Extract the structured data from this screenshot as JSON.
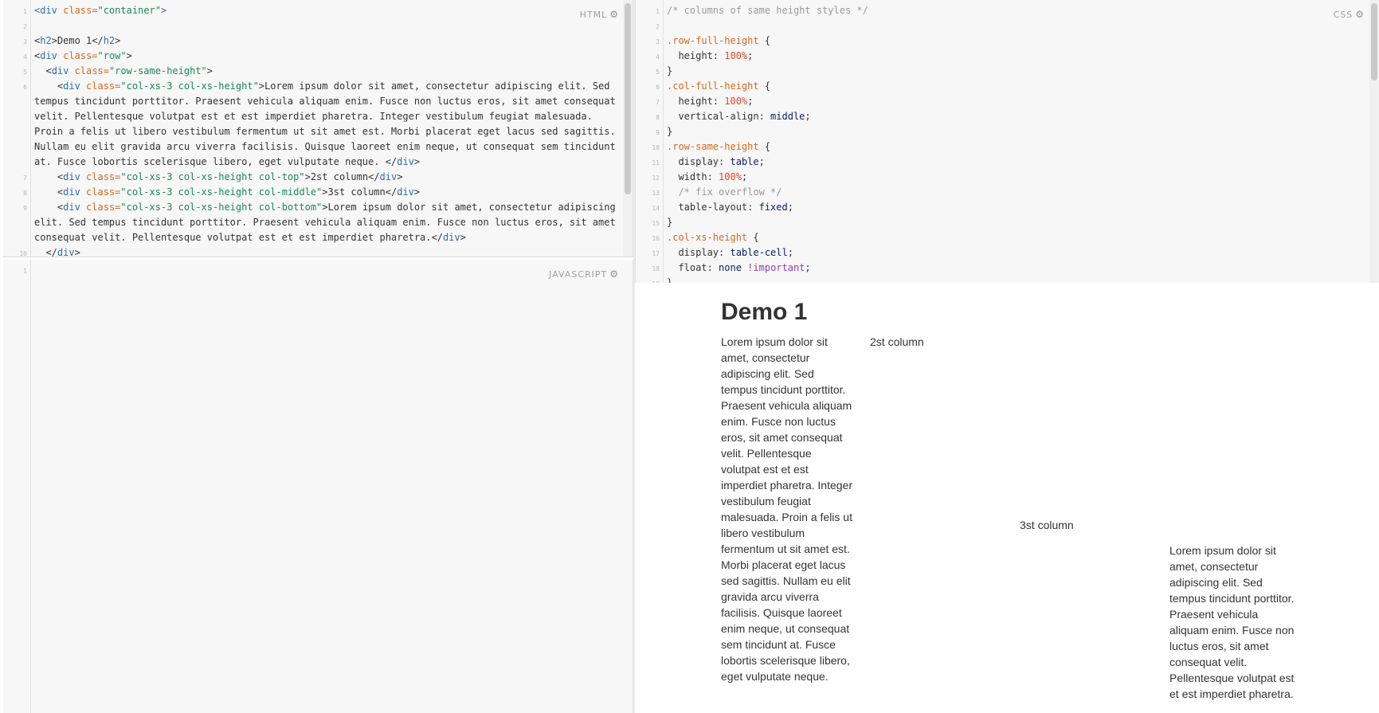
{
  "panes": {
    "html_label": "HTML",
    "js_label": "JAVASCRIPT",
    "css_label": "CSS",
    "gear_icon": "gear-icon"
  },
  "html_code": [
    {
      "n": "1",
      "segs": [
        [
          "t",
          "<div "
        ],
        [
          "a",
          "class="
        ],
        [
          "s",
          "\"container\""
        ],
        [
          "t",
          ">"
        ]
      ]
    },
    {
      "n": "2",
      "segs": []
    },
    {
      "n": "3",
      "segs": [
        [
          "p",
          "<"
        ],
        [
          "t",
          "h2"
        ],
        [
          "p",
          ">Demo 1</"
        ],
        [
          "t",
          "h2"
        ],
        [
          "p",
          ">"
        ]
      ]
    },
    {
      "n": "4",
      "segs": [
        [
          "p",
          "<"
        ],
        [
          "t",
          "div "
        ],
        [
          "a",
          "class="
        ],
        [
          "s",
          "\"row\""
        ],
        [
          "p",
          ">"
        ]
      ]
    },
    {
      "n": "5",
      "segs": [
        [
          "p",
          "  <"
        ],
        [
          "t",
          "div "
        ],
        [
          "a",
          "class="
        ],
        [
          "s",
          "\"row-same-height\""
        ],
        [
          "p",
          ">"
        ]
      ]
    },
    {
      "n": "6",
      "segs": [
        [
          "p",
          "    <"
        ],
        [
          "t",
          "div "
        ],
        [
          "a",
          "class="
        ],
        [
          "s",
          "\"col-xs-3 col-xs-height\""
        ],
        [
          "p",
          ">Lorem ipsum dolor sit amet, consectetur adipiscing elit. Sed tempus tincidunt porttitor. Praesent vehicula aliquam enim. Fusce non luctus eros, sit amet consequat velit. Pellentesque volutpat est et est imperdiet pharetra. Integer vestibulum feugiat malesuada. Proin a felis ut libero vestibulum fermentum ut sit amet est. Morbi placerat eget lacus sed sagittis. Nullam eu elit gravida arcu viverra facilisis. Quisque laoreet enim neque, ut consequat sem tincidunt at. Fusce lobortis scelerisque libero, eget vulputate neque. </"
        ],
        [
          "t",
          "div"
        ],
        [
          "p",
          ">"
        ]
      ]
    },
    {
      "n": "7",
      "segs": [
        [
          "p",
          "    <"
        ],
        [
          "t",
          "div "
        ],
        [
          "a",
          "class="
        ],
        [
          "s",
          "\"col-xs-3 col-xs-height col-top\""
        ],
        [
          "p",
          ">2st column</"
        ],
        [
          "t",
          "div"
        ],
        [
          "p",
          ">"
        ]
      ]
    },
    {
      "n": "8",
      "segs": [
        [
          "p",
          "    <"
        ],
        [
          "t",
          "div "
        ],
        [
          "a",
          "class="
        ],
        [
          "s",
          "\"col-xs-3 col-xs-height col-middle\""
        ],
        [
          "p",
          ">3st column</"
        ],
        [
          "t",
          "div"
        ],
        [
          "p",
          ">"
        ]
      ]
    },
    {
      "n": "9",
      "segs": [
        [
          "p",
          "    <"
        ],
        [
          "t",
          "div "
        ],
        [
          "a",
          "class="
        ],
        [
          "s",
          "\"col-xs-3 col-xs-height col-bottom\""
        ],
        [
          "p",
          ">Lorem ipsum dolor sit amet, consectetur adipiscing elit. Sed tempus tincidunt porttitor. Praesent vehicula aliquam enim. Fusce non luctus eros, sit amet consequat velit. Pellentesque volutpat est et est imperdiet pharetra.</"
        ],
        [
          "t",
          "div"
        ],
        [
          "p",
          ">"
        ]
      ]
    },
    {
      "n": "10",
      "segs": [
        [
          "p",
          "  </"
        ],
        [
          "t",
          "div"
        ],
        [
          "p",
          ">"
        ]
      ]
    }
  ],
  "js_code": [
    {
      "n": "1",
      "segs": []
    }
  ],
  "css_code": [
    {
      "n": "1",
      "segs": [
        [
          "cm",
          "/* columns of same height styles */"
        ]
      ]
    },
    {
      "n": "2",
      "segs": []
    },
    {
      "n": "3",
      "segs": [
        [
          "sel",
          ".row-full-height"
        ],
        [
          "p",
          " {"
        ]
      ]
    },
    {
      "n": "4",
      "segs": [
        [
          "p",
          "  height: "
        ],
        [
          "num",
          "100%"
        ],
        [
          "p",
          ";"
        ]
      ]
    },
    {
      "n": "5",
      "segs": [
        [
          "p",
          "}"
        ]
      ]
    },
    {
      "n": "6",
      "segs": [
        [
          "sel",
          ".col-full-height"
        ],
        [
          "p",
          " {"
        ]
      ]
    },
    {
      "n": "7",
      "segs": [
        [
          "p",
          "  height: "
        ],
        [
          "num",
          "100%"
        ],
        [
          "p",
          ";"
        ]
      ]
    },
    {
      "n": "8",
      "segs": [
        [
          "p",
          "  vertical-align: "
        ],
        [
          "kw",
          "middle"
        ],
        [
          "p",
          ";"
        ]
      ]
    },
    {
      "n": "9",
      "segs": [
        [
          "p",
          "}"
        ]
      ]
    },
    {
      "n": "10",
      "segs": [
        [
          "sel",
          ".row-same-height"
        ],
        [
          "p",
          " {"
        ]
      ]
    },
    {
      "n": "11",
      "segs": [
        [
          "p",
          "  display: "
        ],
        [
          "kw",
          "table"
        ],
        [
          "p",
          ";"
        ]
      ]
    },
    {
      "n": "12",
      "segs": [
        [
          "p",
          "  width: "
        ],
        [
          "num",
          "100%"
        ],
        [
          "p",
          ";"
        ]
      ]
    },
    {
      "n": "13",
      "segs": [
        [
          "cm",
          "  /* fix overflow */"
        ]
      ]
    },
    {
      "n": "14",
      "segs": [
        [
          "p",
          "  table-layout: "
        ],
        [
          "kw",
          "fixed"
        ],
        [
          "p",
          ";"
        ]
      ]
    },
    {
      "n": "15",
      "segs": [
        [
          "p",
          "}"
        ]
      ]
    },
    {
      "n": "16",
      "segs": [
        [
          "sel",
          ".col-xs-height"
        ],
        [
          "p",
          " {"
        ]
      ]
    },
    {
      "n": "17",
      "segs": [
        [
          "p",
          "  display: "
        ],
        [
          "kw",
          "table-cell"
        ],
        [
          "p",
          ";"
        ]
      ]
    },
    {
      "n": "18",
      "segs": [
        [
          "p",
          "  float: "
        ],
        [
          "kw",
          "none"
        ],
        [
          "p",
          " "
        ],
        [
          "imp",
          "!important"
        ],
        [
          "p",
          ";"
        ]
      ]
    },
    {
      "n": "19",
      "segs": [
        [
          "p",
          "}"
        ]
      ]
    }
  ],
  "result": {
    "title": "Demo 1",
    "col1": "Lorem ipsum dolor sit amet, consectetur adipiscing elit. Sed tempus tincidunt porttitor. Praesent vehicula aliquam enim. Fusce non luctus eros, sit amet consequat velit. Pellentesque volutpat est et est imperdiet pharetra. Integer vestibulum feugiat malesuada. Proin a felis ut libero vestibulum fermentum ut sit amet est. Morbi placerat eget lacus sed sagittis. Nullam eu elit gravida arcu viverra facilisis. Quisque laoreet enim neque, ut consequat sem tincidunt at. Fusce lobortis scelerisque libero, eget vulputate neque.",
    "col2": "2st column",
    "col3": "3st column",
    "col4": "Lorem ipsum dolor sit amet, consectetur adipiscing elit. Sed tempus tincidunt porttitor. Praesent vehicula aliquam enim. Fusce non luctus eros, sit amet consequat velit. Pellentesque volutpat est et est imperdiet pharetra."
  }
}
